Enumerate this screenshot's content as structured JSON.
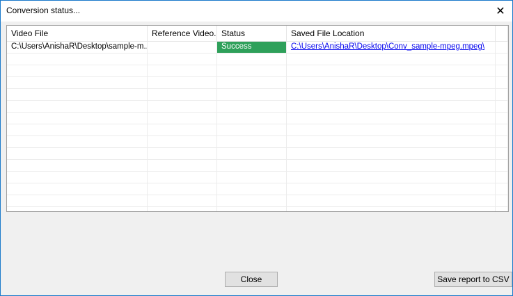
{
  "window": {
    "title": "Conversion status...",
    "close_glyph": "✕"
  },
  "table": {
    "columns": [
      "Video File",
      "Reference Video...",
      "Status",
      "Saved File Location"
    ],
    "rows": [
      {
        "video_file": "C:\\Users\\AnishaR\\Desktop\\sample-m...",
        "reference_video": "",
        "status": "Success",
        "saved_location": "C:\\Users\\AnishaR\\Desktop\\Conv_sample-mpeg.mpeg\\"
      }
    ],
    "status_color": "#2ea05a"
  },
  "buttons": {
    "close_label": "Close",
    "save_csv_label": "Save report to CSV"
  }
}
